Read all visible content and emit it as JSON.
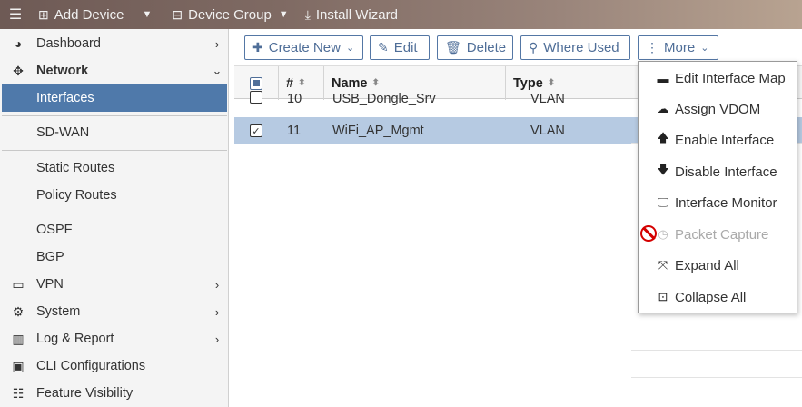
{
  "topbar": {
    "add_device": "Add Device",
    "device_group": "Device Group",
    "install_wizard": "Install Wizard"
  },
  "sidebar": {
    "items": [
      {
        "label": "Dashboard",
        "icon": "dashboard-icon"
      },
      {
        "label": "Network",
        "icon": "network-icon"
      },
      {
        "label": "Interfaces"
      },
      {
        "label": "SD-WAN"
      },
      {
        "label": "Static Routes"
      },
      {
        "label": "Policy Routes"
      },
      {
        "label": "OSPF"
      },
      {
        "label": "BGP"
      },
      {
        "label": "VPN",
        "icon": "laptop-icon"
      },
      {
        "label": "System",
        "icon": "gear-icon"
      },
      {
        "label": "Log & Report",
        "icon": "chart-icon"
      },
      {
        "label": "CLI Configurations",
        "icon": "terminal-icon"
      },
      {
        "label": "Feature Visibility",
        "icon": "list-icon"
      }
    ]
  },
  "toolbar": {
    "create_new": "Create New",
    "edit": "Edit",
    "delete": "Delete",
    "where_used": "Where Used",
    "more": "More"
  },
  "grid": {
    "columns": [
      "#",
      "Name",
      "Type"
    ],
    "rows": [
      {
        "num": "10",
        "name": "USB_Dongle_Srv",
        "type": "VLAN",
        "checked": false
      },
      {
        "num": "11",
        "name": "WiFi_AP_Mgmt",
        "type": "VLAN",
        "checked": true
      }
    ]
  },
  "more_menu": {
    "items": [
      {
        "label": "Edit Interface Map",
        "icon": "map-icon"
      },
      {
        "label": "Assign VDOM",
        "icon": "cloud-icon"
      },
      {
        "label": "Enable Interface",
        "icon": "arrow-up-icon"
      },
      {
        "label": "Disable Interface",
        "icon": "arrow-down-icon"
      },
      {
        "label": "Interface Monitor",
        "icon": "monitor-icon"
      },
      {
        "label": "Packet Capture",
        "icon": "clock-icon",
        "disabled": true
      },
      {
        "label": "Expand All",
        "icon": "expand-icon"
      },
      {
        "label": "Collapse All",
        "icon": "collapse-icon"
      }
    ]
  },
  "colors": {
    "active_nav": "#4f79aa",
    "selected_row": "#b6cae2",
    "button_border": "#5477a5"
  }
}
